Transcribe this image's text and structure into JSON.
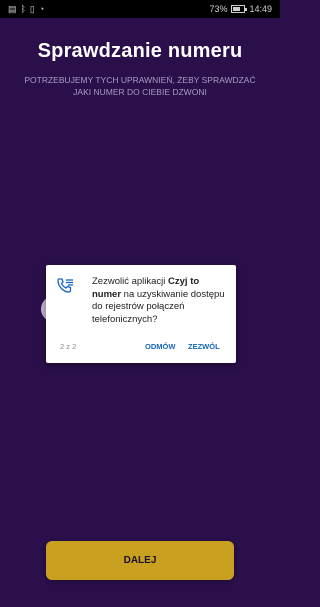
{
  "status_bar": {
    "left_icons": [
      "sim-icon",
      "bluetooth-icon",
      "vibrate-icon",
      "wifi-icon"
    ],
    "battery_percent": "73%",
    "time": "14:49"
  },
  "header": {
    "title": "Sprawdzanie numeru",
    "subtitle": "POTRZEBUJEMY TYCH UPRAWNIEŃ, ŻEBY SPRAWDZAĆ JAKI NUMER DO CIEBIE DZWONI"
  },
  "dialog": {
    "icon": "call-log-icon",
    "message_prefix": "Zezwolić aplikacji ",
    "app_name": "Czyj to numer",
    "message_suffix": " na uzyskiwanie dostępu do rejestrów połączeń telefonicznych?",
    "counter": "2 z 2",
    "deny_label": "ODMÓW",
    "allow_label": "ZEZWÓL"
  },
  "footer": {
    "next_label": "DALEJ"
  },
  "colors": {
    "background": "#2a0f4a",
    "accent": "#caa020",
    "dialog_button": "#1565c0"
  }
}
